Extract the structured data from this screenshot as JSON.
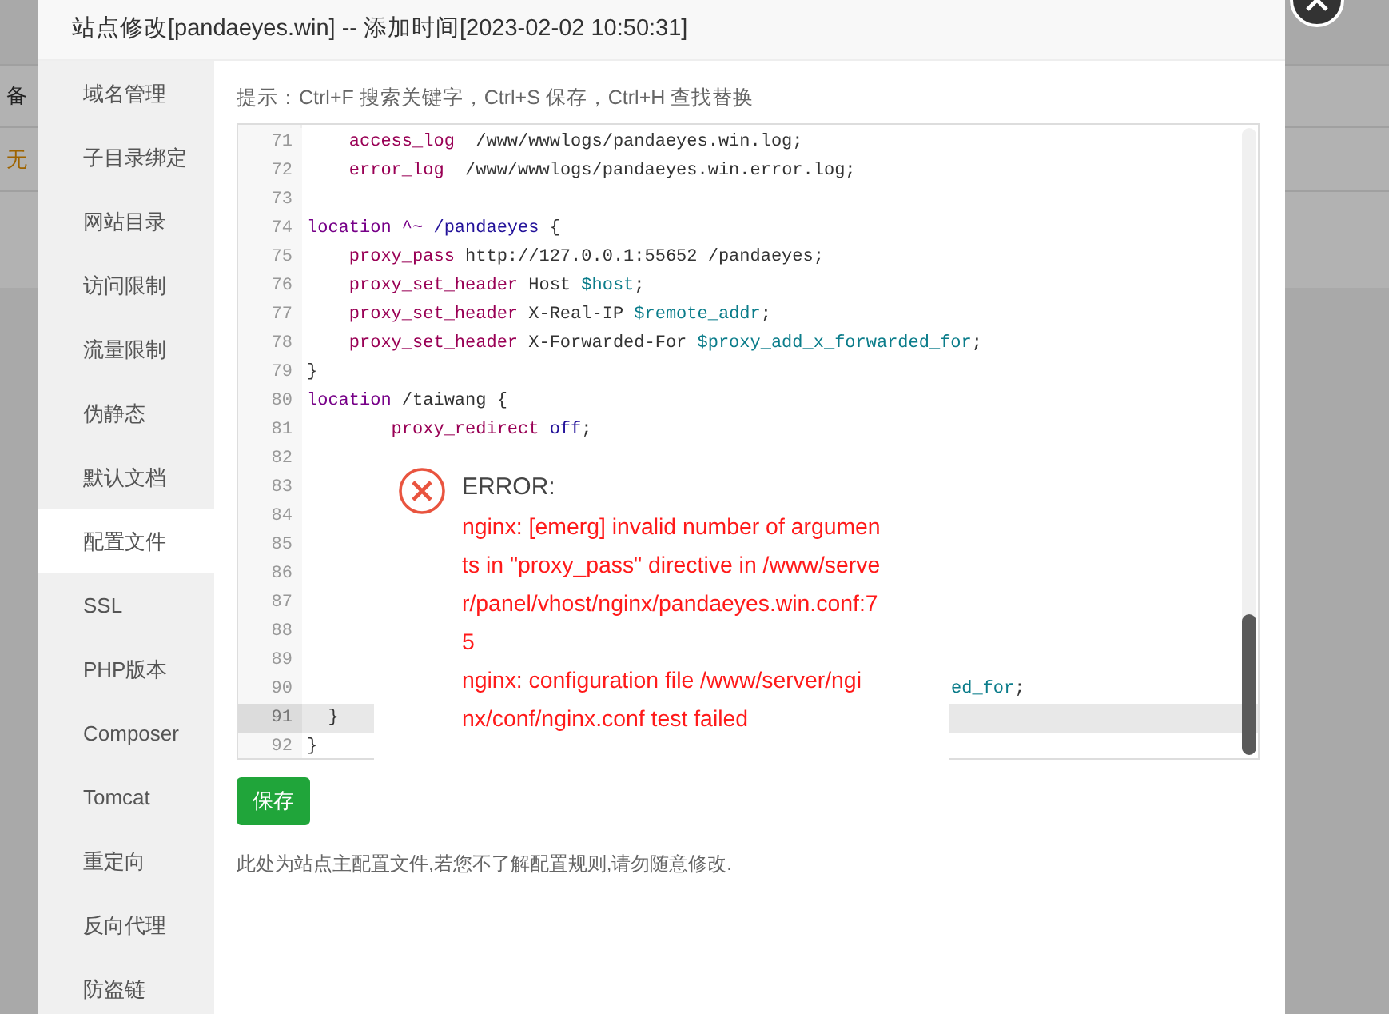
{
  "background": {
    "row_labels": [
      {
        "text": "备",
        "kind": "plain"
      },
      {
        "text": "无",
        "kind": "warning"
      }
    ]
  },
  "modal": {
    "title": "站点修改[pandaeyes.win] -- 添加时间[2023-02-02 10:50:31]",
    "sidebar": [
      {
        "label": "域名管理",
        "selected": false
      },
      {
        "label": "子目录绑定",
        "selected": false
      },
      {
        "label": "网站目录",
        "selected": false
      },
      {
        "label": "访问限制",
        "selected": false
      },
      {
        "label": "流量限制",
        "selected": false
      },
      {
        "label": "伪静态",
        "selected": false
      },
      {
        "label": "默认文档",
        "selected": false
      },
      {
        "label": "配置文件",
        "selected": true
      },
      {
        "label": "SSL",
        "selected": false
      },
      {
        "label": "PHP版本",
        "selected": false
      },
      {
        "label": "Composer",
        "selected": false
      },
      {
        "label": "Tomcat",
        "selected": false
      },
      {
        "label": "重定向",
        "selected": false
      },
      {
        "label": "反向代理",
        "selected": false
      },
      {
        "label": "防盗链",
        "selected": false
      }
    ],
    "hint": "提示：Ctrl+F 搜索关键字，Ctrl+S 保存，Ctrl+H 查找替换",
    "editor": {
      "lines": [
        {
          "number": "71",
          "active": false,
          "segments": [
            {
              "text": "    access_log",
              "kind": "directive"
            },
            {
              "text": "  /www/wwwlogs/pandaeyes.win.log;",
              "kind": "plain"
            }
          ]
        },
        {
          "number": "72",
          "active": false,
          "segments": [
            {
              "text": "    error_log",
              "kind": "directive"
            },
            {
              "text": "  /www/wwwlogs/pandaeyes.win.error.log;",
              "kind": "plain"
            }
          ]
        },
        {
          "number": "73",
          "active": false
        },
        {
          "number": "74",
          "active": false,
          "segments": [
            {
              "text": "location ^~",
              "kind": "keyword"
            },
            {
              "text": " /pandaeyes",
              "kind": "atom"
            },
            {
              "text": " {",
              "kind": "plain"
            }
          ]
        },
        {
          "number": "75",
          "active": false,
          "segments": [
            {
              "text": "    proxy_pass",
              "kind": "directive"
            },
            {
              "text": " http://127.0.0.1:55652 /pandaeyes;",
              "kind": "plain"
            }
          ]
        },
        {
          "number": "76",
          "active": false,
          "segments": [
            {
              "text": "    proxy_set_header",
              "kind": "directive"
            },
            {
              "text": " Host ",
              "kind": "plain"
            },
            {
              "text": "$host",
              "kind": "variable"
            },
            {
              "text": ";",
              "kind": "plain"
            }
          ]
        },
        {
          "number": "77",
          "active": false,
          "segments": [
            {
              "text": "    proxy_set_header",
              "kind": "directive"
            },
            {
              "text": " X-Real-IP ",
              "kind": "plain"
            },
            {
              "text": "$remote_addr",
              "kind": "variable"
            },
            {
              "text": ";",
              "kind": "plain"
            }
          ]
        },
        {
          "number": "78",
          "active": false,
          "segments": [
            {
              "text": "    proxy_set_header",
              "kind": "directive"
            },
            {
              "text": " X-Forwarded-For ",
              "kind": "plain"
            },
            {
              "text": "$proxy_add_x_forwarded_for",
              "kind": "variable"
            },
            {
              "text": ";",
              "kind": "plain"
            }
          ]
        },
        {
          "number": "79",
          "active": false,
          "segments": [
            {
              "text": "}",
              "kind": "plain"
            }
          ]
        },
        {
          "number": "80",
          "active": false,
          "segments": [
            {
              "text": "location",
              "kind": "keyword"
            },
            {
              "text": " /taiwang {",
              "kind": "plain"
            }
          ]
        },
        {
          "number": "81",
          "active": false,
          "segments": [
            {
              "text": "        proxy_redirect",
              "kind": "directive"
            },
            {
              "text": " off",
              "kind": "atom"
            },
            {
              "text": ";",
              "kind": "plain"
            }
          ]
        },
        {
          "number": "82",
          "active": false
        },
        {
          "number": "83",
          "active": false
        },
        {
          "number": "84",
          "active": false
        },
        {
          "number": "85",
          "active": false
        },
        {
          "number": "86",
          "active": false
        },
        {
          "number": "87",
          "active": false
        },
        {
          "number": "88",
          "active": false
        },
        {
          "number": "89",
          "active": false
        },
        {
          "number": "90",
          "active": false,
          "segments": [
            {
              "text": "ed_for",
              "kind": "cut_variable"
            },
            {
              "text": ";",
              "kind": "plain"
            }
          ]
        },
        {
          "number": "91",
          "active": true,
          "segments": [
            {
              "text": "  }",
              "kind": "plain"
            }
          ]
        },
        {
          "number": "92",
          "active": false,
          "segments": [
            {
              "text": "}",
              "kind": "plain"
            }
          ]
        }
      ]
    },
    "save_button": "保存",
    "note": "此处为站点主配置文件,若您不了解配置规则,请勿随意修改."
  },
  "error_dialog": {
    "title": "ERROR:",
    "lines": [
      "nginx: [emerg] invalid number of argumen",
      "ts in \"proxy_pass\" directive in /www/serve",
      "r/panel/vhost/nginx/pandaeyes.win.conf:7",
      "5",
      "nginx: configuration file /www/server/ngi",
      "nx/conf/nginx.conf test failed"
    ]
  }
}
